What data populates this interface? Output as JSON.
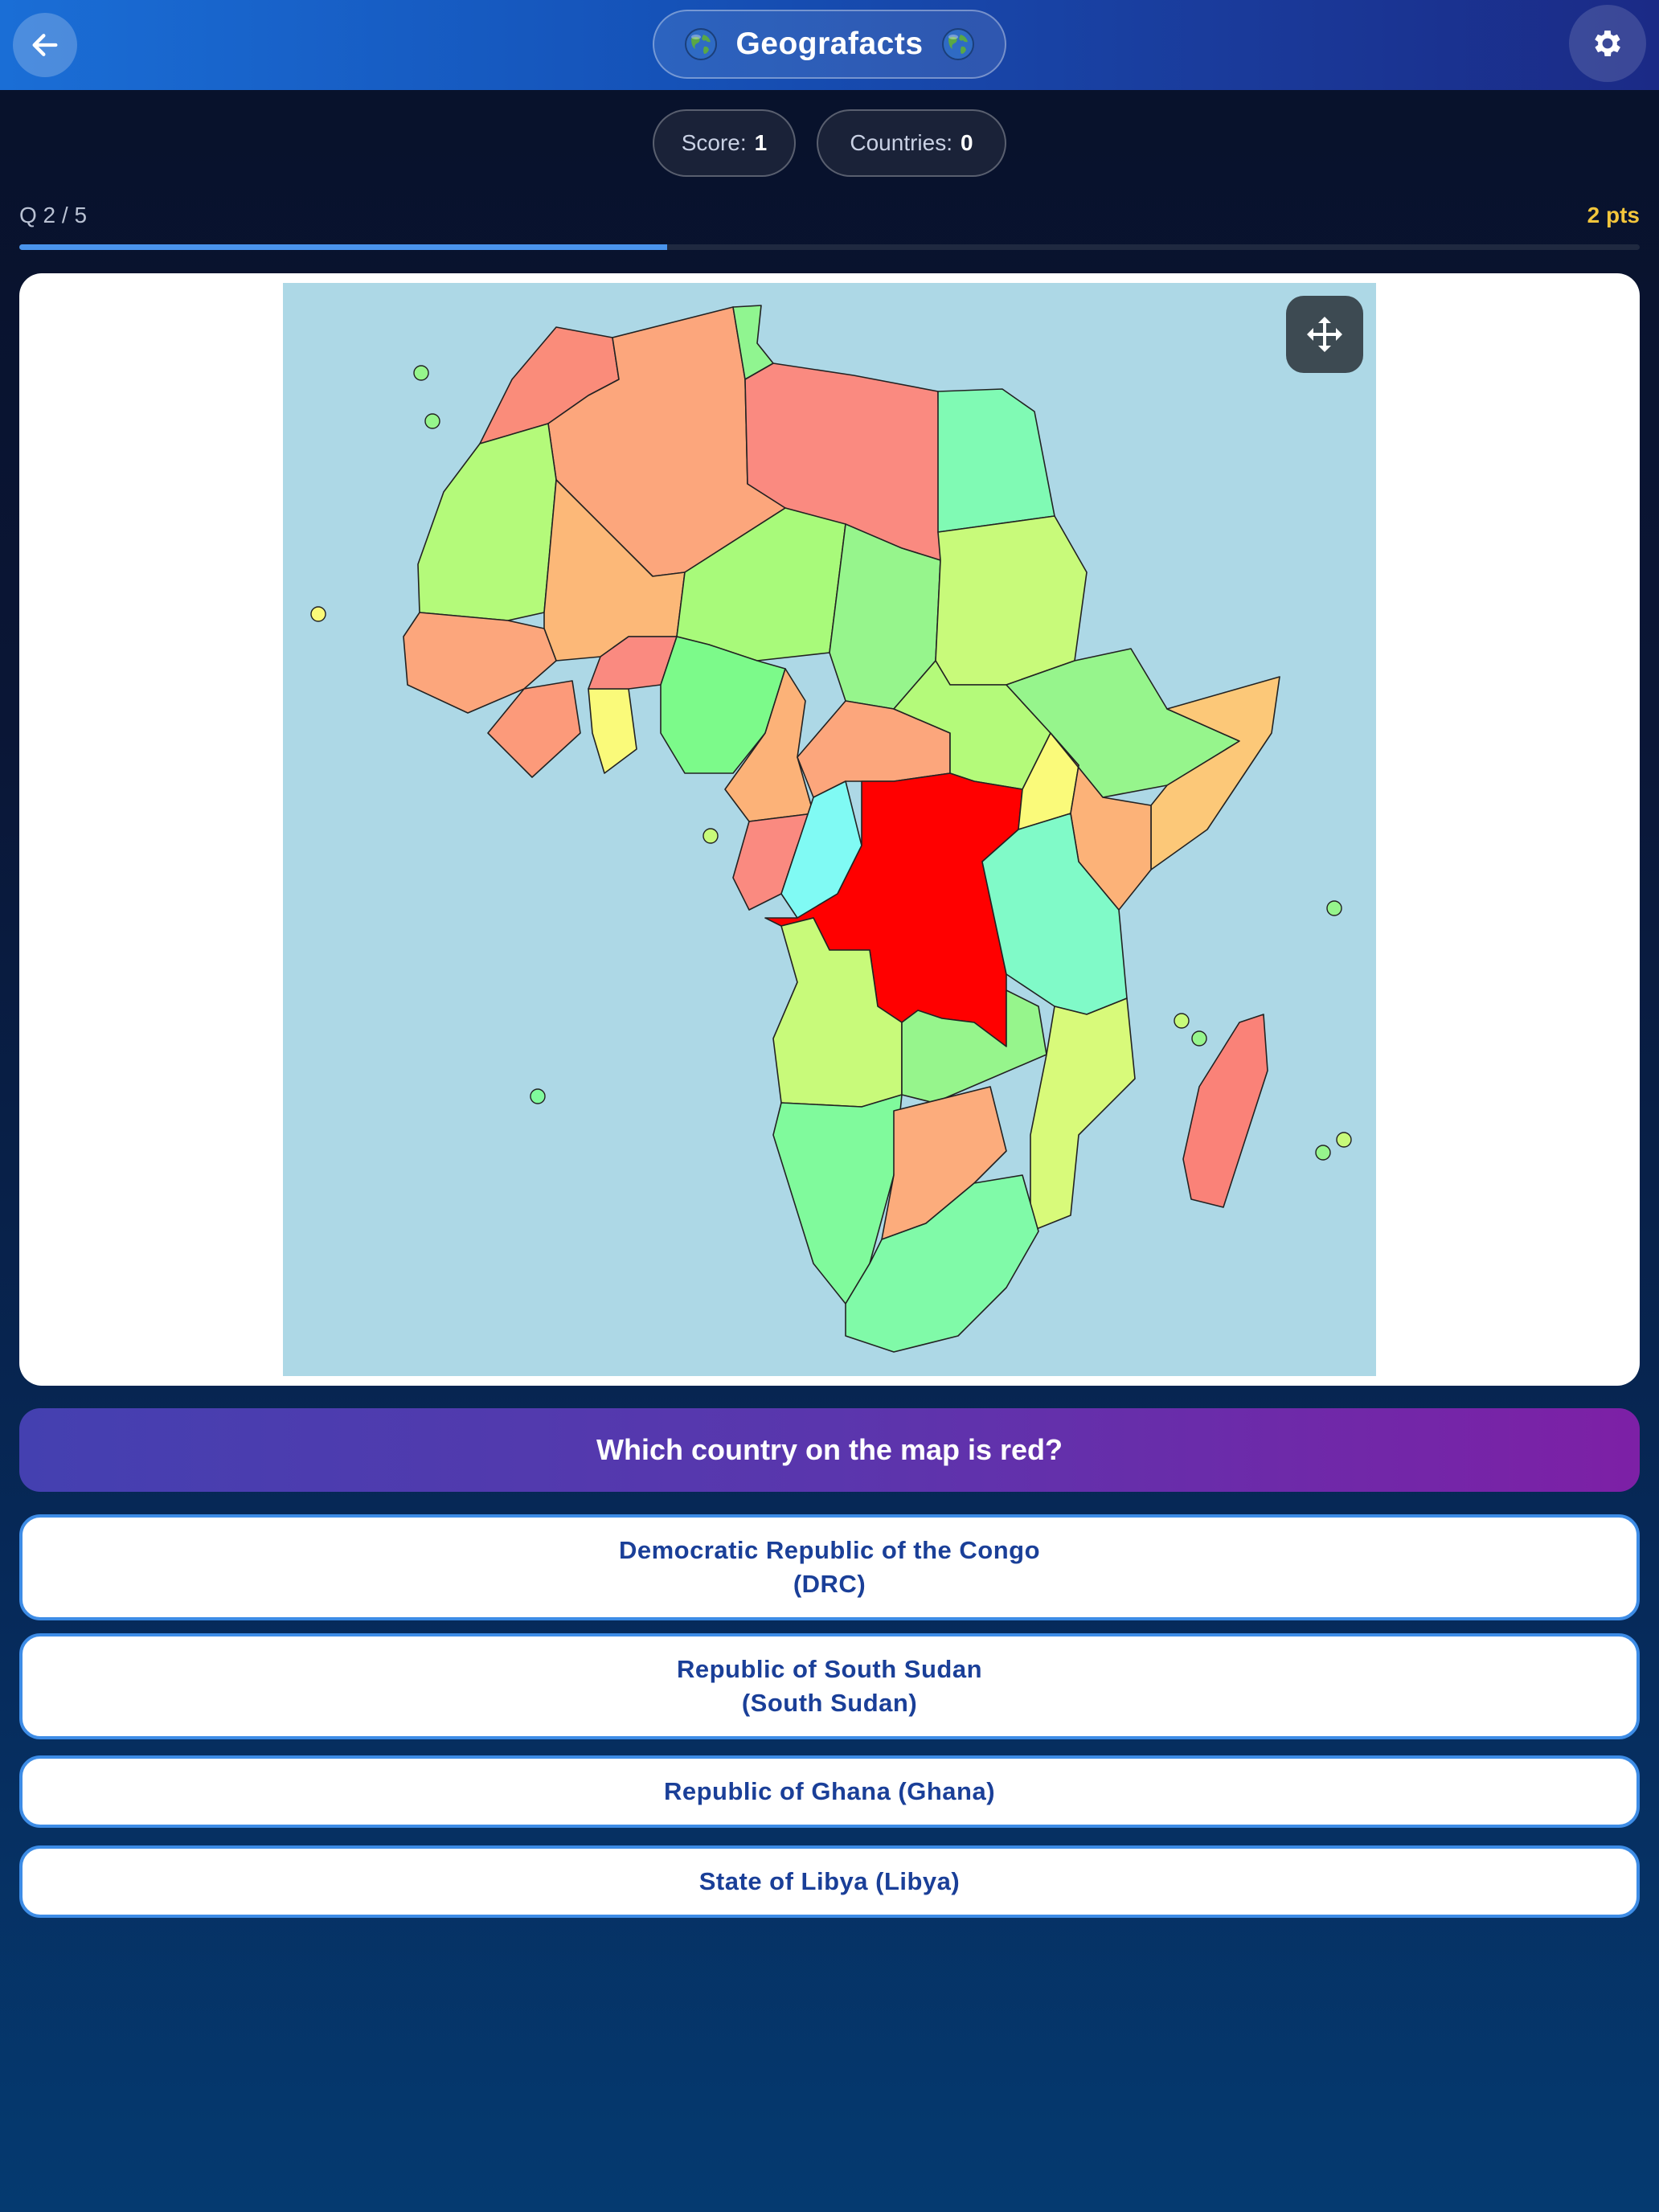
{
  "header": {
    "title": "Geografacts",
    "back_icon": "arrow-left-icon",
    "settings_icon": "gear-icon",
    "decor_icon": "globe-icon"
  },
  "stats": {
    "score_label": "Score:",
    "score_value": "1",
    "countries_label": "Countries:",
    "countries_value": "0"
  },
  "quiz": {
    "counter": "Q 2 / 5",
    "points": "2 pts",
    "progress_fraction": 0.4
  },
  "map": {
    "highlight_color": "#ff0000",
    "ocean_color": "#add8e6",
    "move_icon": "move-arrows-icon"
  },
  "question": {
    "text": "Which country on the map is red?"
  },
  "answers": [
    {
      "line1": "Democratic Republic of the Congo",
      "line2": "(DRC)"
    },
    {
      "line1": "Republic of South Sudan",
      "line2": "(South Sudan)"
    },
    {
      "line1": "Republic of Ghana (Ghana)"
    },
    {
      "line1": "State of Libya (Libya)"
    }
  ],
  "colors": {
    "accent": "#3d8ce6",
    "points": "#f3c63c",
    "answer_text": "#1a3f98"
  }
}
